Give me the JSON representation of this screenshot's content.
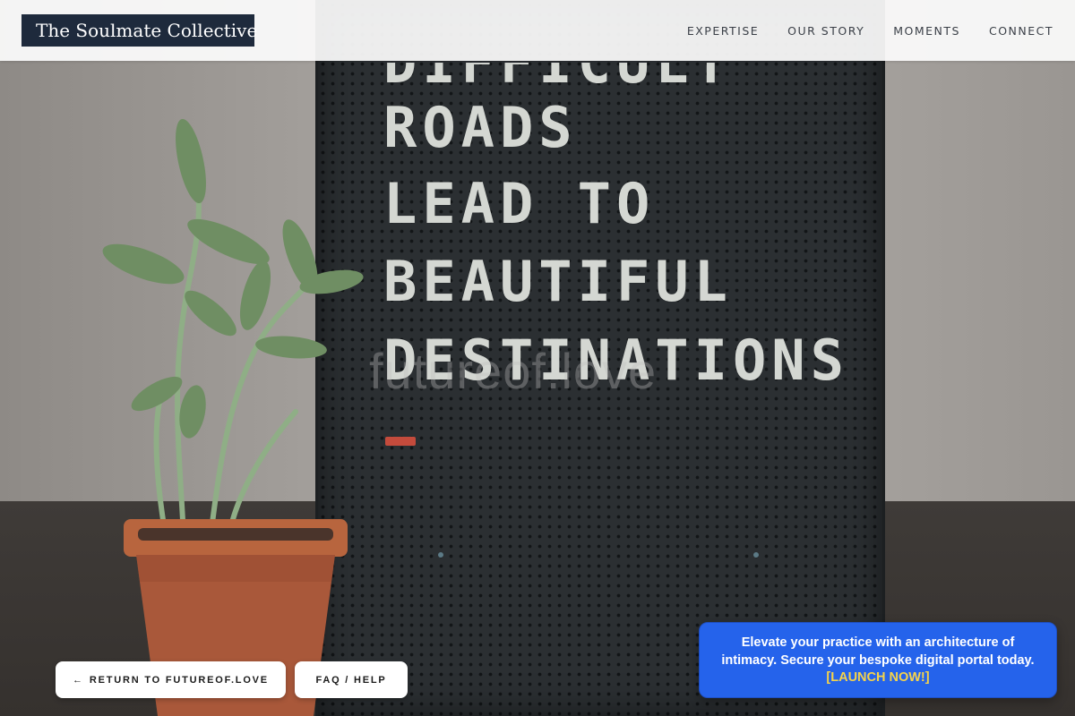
{
  "header": {
    "logo_text": "The Soulmate Collective",
    "nav": [
      {
        "label": "EXPERTISE"
      },
      {
        "label": "OUR STORY"
      },
      {
        "label": "MOMENTS"
      },
      {
        "label": "CONNECT"
      }
    ]
  },
  "hero": {
    "board_lines": [
      "DIFFICULT",
      "ROADS",
      "LEAD TO",
      "BEAUTIFUL",
      "DESTINATIONS"
    ],
    "watermark": "futureof.love"
  },
  "footer_buttons": {
    "return_arrow": "←",
    "return_label": "RETURN TO FUTUREOF.LOVE",
    "faq_label": "FAQ / HELP"
  },
  "promo": {
    "text": "Elevate your practice with an architecture of intimacy. Secure your bespoke digital portal today.",
    "cta": "[LAUNCH NOW!]"
  },
  "colors": {
    "logo_bg": "#1e2a3c",
    "promo_bg": "#2563eb",
    "promo_cta": "#f6d34a"
  }
}
